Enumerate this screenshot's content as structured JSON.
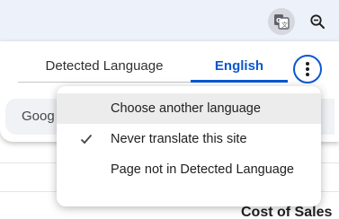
{
  "toolbar": {
    "translate_icon": "translate-icon",
    "zoom_icon": "zoom-out-icon"
  },
  "bubble": {
    "tabs": [
      {
        "label": "Detected Language",
        "selected": false
      },
      {
        "label": "English",
        "selected": true
      }
    ],
    "more_icon": "more-vert-icon",
    "search_row_text": "Goog"
  },
  "menu": {
    "items": [
      {
        "label": "Choose another language",
        "checked": false,
        "hovered": true
      },
      {
        "label": "Never translate this site",
        "checked": true,
        "hovered": false
      },
      {
        "label": "Page not in Detected Language",
        "checked": false,
        "hovered": false
      }
    ]
  },
  "page": {
    "heading": "Cost of Sales"
  },
  "colors": {
    "accent": "#0b57d0",
    "toolbar_bg": "#edf1f9",
    "hover_bg": "#ececec"
  }
}
